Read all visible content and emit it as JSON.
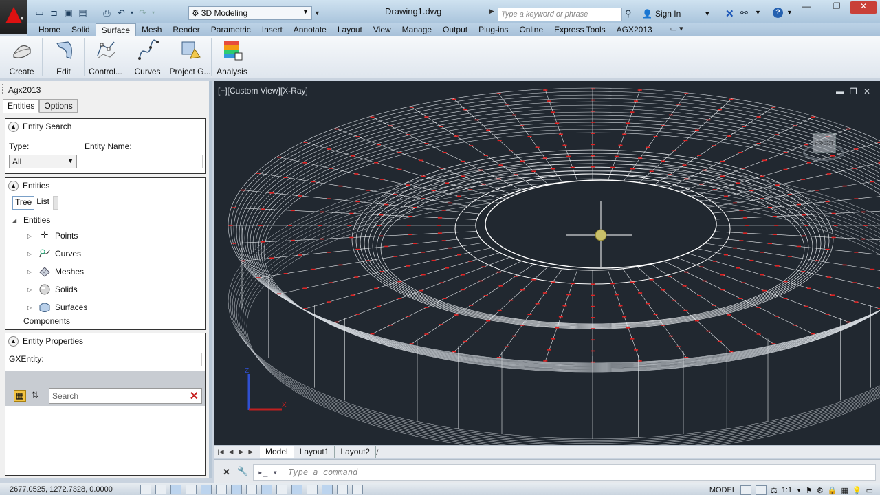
{
  "titlebar": {
    "workspace": "3D Modeling",
    "document": "Drawing1.dwg",
    "search_placeholder": "Type a keyword or phrase",
    "signin": "Sign In"
  },
  "ribbon_tabs": [
    "Home",
    "Solid",
    "Surface",
    "Mesh",
    "Render",
    "Parametric",
    "Insert",
    "Annotate",
    "Layout",
    "View",
    "Manage",
    "Output",
    "Plug-ins",
    "Online",
    "Express Tools",
    "AGX2013"
  ],
  "active_tab": "Surface",
  "ribbon_buttons": [
    "Create",
    "Edit",
    "Control...",
    "Curves",
    "Project G...",
    "Analysis"
  ],
  "palette": {
    "title": "Agx2013",
    "tabs": [
      "Entities",
      "Options"
    ],
    "entity_search": {
      "header": "Entity Search",
      "type_label": "Type:",
      "type_value": "All",
      "name_label": "Entity Name:"
    },
    "entities": {
      "header": "Entities",
      "subtabs": [
        "Tree",
        "List"
      ],
      "root": "Entities",
      "children": [
        "Points",
        "Curves",
        "Meshes",
        "Solids",
        "Surfaces"
      ],
      "components": "Components"
    },
    "properties": {
      "header": "Entity Properties",
      "gx_label": "GXEntity:",
      "search_placeholder": "Search"
    }
  },
  "viewport": {
    "label": "[−][Custom View][X-Ray]",
    "cube_face": "FRONT"
  },
  "layout_tabs": [
    "Model",
    "Layout1",
    "Layout2"
  ],
  "command": {
    "placeholder": "Type a command"
  },
  "status": {
    "coords": "2677.0525, 1272.7328, 0.0000",
    "model": "MODEL",
    "scale": "1:1"
  }
}
